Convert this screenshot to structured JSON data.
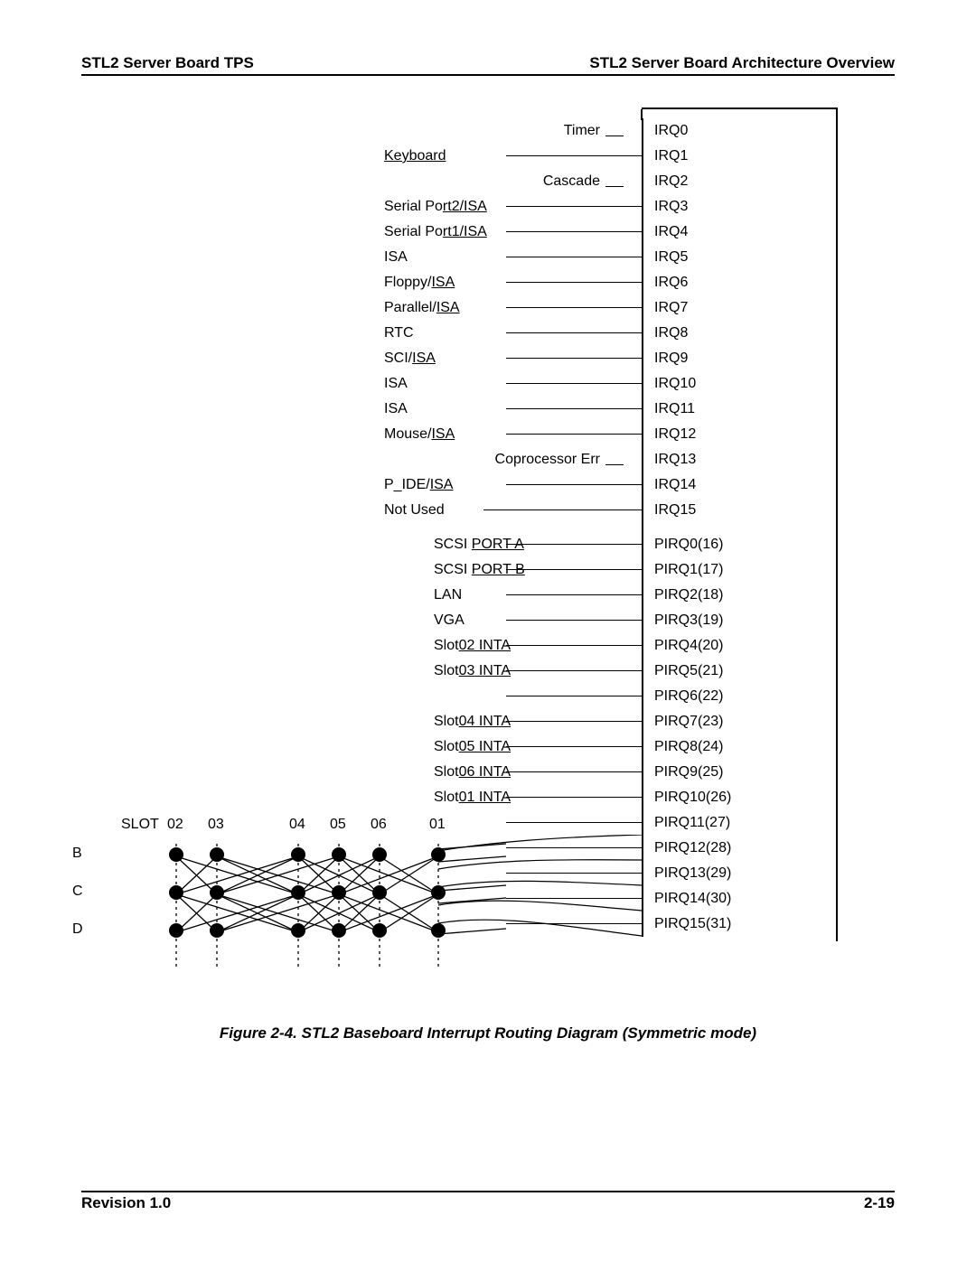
{
  "header": {
    "left": "STL2 Server Board TPS",
    "right": "STL2 Server Board Architecture Overview"
  },
  "footer": {
    "left": "Revision 1.0",
    "right": "2-19"
  },
  "caption": "Figure 2-4. STL2 Baseboard Interrupt Routing Diagram (Symmetric mode)",
  "irq_rows": [
    {
      "device": "Timer",
      "irq": "IRQ0",
      "align": "right",
      "short": true
    },
    {
      "device": "Keyboard",
      "irq": "IRQ1",
      "underline_tail": true
    },
    {
      "device": "Cascade",
      "irq": "IRQ2",
      "align": "right",
      "short": true
    },
    {
      "device": "Serial Port2/ISA",
      "irq": "IRQ3",
      "underline_tail": true,
      "tail_from": 9
    },
    {
      "device": "Serial Port1/ISA",
      "irq": "IRQ4",
      "underline_tail": true,
      "tail_from": 9
    },
    {
      "device": "ISA",
      "irq": "IRQ5",
      "line_after": true
    },
    {
      "device": "Floppy/ISA",
      "irq": "IRQ6",
      "underline_tail": true,
      "tail_from": 7
    },
    {
      "device": "Parallel/ISA",
      "irq": "IRQ7",
      "underline_tail": true,
      "tail_from": 9
    },
    {
      "device": "RTC",
      "irq": "IRQ8",
      "line_after": true
    },
    {
      "device": "SCI/ISA",
      "irq": "IRQ9",
      "underline_tail": true,
      "tail_from": 4
    },
    {
      "device": "ISA",
      "irq": "IRQ10",
      "line_after": true
    },
    {
      "device": "ISA",
      "irq": "IRQ11",
      "line_after": true
    },
    {
      "device": "Mouse/ISA",
      "irq": "IRQ12",
      "underline_tail": true,
      "tail_from": 6
    },
    {
      "device": "Coprocessor Err",
      "irq": "IRQ13",
      "align": "right",
      "short": true
    },
    {
      "device": "P_IDE/ISA",
      "irq": "IRQ14",
      "underline_tail": true,
      "tail_from": 6
    },
    {
      "device": "Not Used",
      "irq": "IRQ15",
      "line_after_solid": true
    }
  ],
  "pirq_rows": [
    {
      "device": "SCSI PORT A",
      "irq": "PIRQ0(16)",
      "underline_tail": true,
      "tail_from": 5
    },
    {
      "device": "SCSI PORT B",
      "irq": "PIRQ1(17)",
      "underline_tail": true,
      "tail_from": 5
    },
    {
      "device": "LAN",
      "irq": "PIRQ2(18)",
      "line_after": true
    },
    {
      "device": "VGA",
      "irq": "PIRQ3(19)",
      "underline_tail": true,
      "tail_from": 3
    },
    {
      "device": "Slot02 INTA",
      "irq": "PIRQ4(20)",
      "underline_tail": true,
      "tail_from": 4
    },
    {
      "device": "Slot03 INTA",
      "irq": "PIRQ5(21)",
      "underline_tail": true,
      "tail_from": 4
    },
    {
      "device": "",
      "irq": "PIRQ6(22)",
      "line_only": true
    },
    {
      "device": "Slot04 INTA",
      "irq": "PIRQ7(23)",
      "underline_tail": true,
      "tail_from": 4
    },
    {
      "device": "Slot05 INTA",
      "irq": "PIRQ8(24)",
      "underline_tail": true,
      "tail_from": 4
    },
    {
      "device": "Slot06 INTA",
      "irq": "PIRQ9(25)",
      "underline_tail": true,
      "tail_from": 4
    },
    {
      "device": "Slot01 INTA",
      "irq": "PIRQ10(26)",
      "underline_tail": true,
      "tail_from": 4
    },
    {
      "device": "",
      "irq": "PIRQ11(27)",
      "line_only": true
    },
    {
      "device": "",
      "irq": "PIRQ12(28)",
      "line_only": true
    },
    {
      "device": "",
      "irq": "PIRQ13(29)",
      "line_only": true
    },
    {
      "device": "",
      "irq": "PIRQ14(30)",
      "line_only": true
    },
    {
      "device": "",
      "irq": "PIRQ15(31)",
      "line_only": true
    }
  ],
  "slot": {
    "label": "SLOT",
    "cols": [
      "02",
      "03",
      "04",
      "05",
      "06",
      "01"
    ],
    "rows": [
      "B",
      "C",
      "D"
    ]
  }
}
